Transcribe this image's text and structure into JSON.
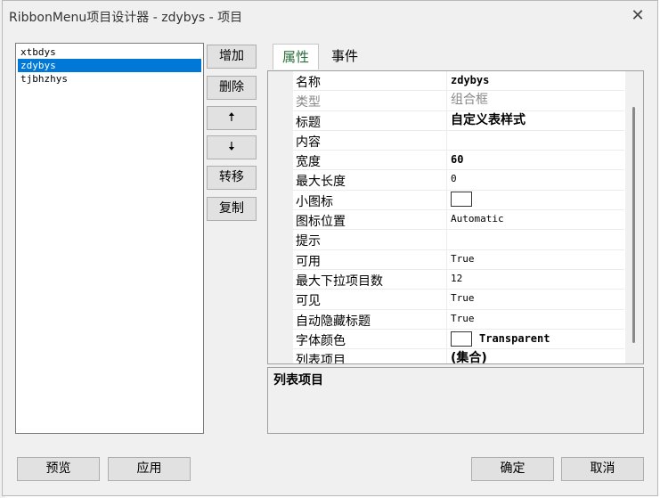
{
  "window": {
    "title": "RibbonMenu项目设计器 - zdybys - 项目"
  },
  "list": {
    "items": [
      "xtbdys",
      "zdybys",
      "tjbhzhys"
    ],
    "selected_index": 1
  },
  "side_buttons": {
    "add": "增加",
    "delete": "删除",
    "up": "🠅",
    "down": "🠇",
    "move": "转移",
    "copy": "复制"
  },
  "tabs": [
    "属性",
    "事件"
  ],
  "properties": [
    {
      "name": "名称",
      "value": "zdybys"
    },
    {
      "name": "类型",
      "value": "组合框"
    },
    {
      "name": "标题",
      "value": "自定义表样式"
    },
    {
      "name": "内容",
      "value": ""
    },
    {
      "name": "宽度",
      "value": "60"
    },
    {
      "name": "最大长度",
      "value": "0"
    },
    {
      "name": "小图标",
      "value": ""
    },
    {
      "name": "图标位置",
      "value": "Automatic"
    },
    {
      "name": "提示",
      "value": ""
    },
    {
      "name": "可用",
      "value": "True"
    },
    {
      "name": "最大下拉项目数",
      "value": "12"
    },
    {
      "name": "可见",
      "value": "True"
    },
    {
      "name": "自动隐藏标题",
      "value": "True"
    },
    {
      "name": "字体颜色",
      "value": "Transparent"
    },
    {
      "name": "列表项目",
      "value": "(集合)"
    }
  ],
  "description": {
    "title": "列表项目"
  },
  "bottom_buttons": {
    "preview": "预览",
    "apply": "应用",
    "ok": "确定",
    "cancel": "取消"
  }
}
